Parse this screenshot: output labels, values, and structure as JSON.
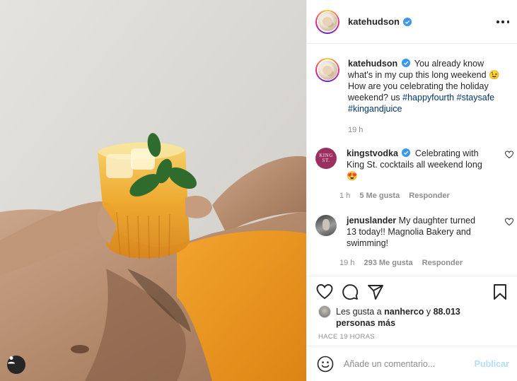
{
  "post": {
    "author": "katehudson",
    "more_icon": "more-horizontal-icon",
    "photo_alt": "photo",
    "tag_icon": "user-tag-icon"
  },
  "caption": {
    "username": "katehudson",
    "text_1": "You already know what's in my cup this long weekend",
    "emoji_1": "😉",
    "text_2": "How are you celebrating the holiday weekend? us",
    "hashtags": [
      "#happyfourth",
      "#staysafe",
      "#kingandjuice"
    ],
    "time": "19 h"
  },
  "comments": [
    {
      "username": "kingstvodka",
      "verified": true,
      "avatar_text": [
        "KING",
        "ST."
      ],
      "text": "Celebrating with King St. cocktails all weekend long",
      "emoji": "😍",
      "time": "1 h",
      "likes": "5 Me gusta",
      "reply": "Responder"
    },
    {
      "username": "jenuslander",
      "verified": false,
      "text": "My daughter turned 13 today!! Magnolia Bakery and swimming!",
      "time": "19 h",
      "likes": "293 Me gusta",
      "reply": "Responder"
    }
  ],
  "actions": {
    "icons": [
      "heart-icon",
      "comment-icon",
      "share-icon",
      "bookmark-icon"
    ],
    "likes_prefix": "Les gusta a",
    "likes_user": "nanherco",
    "likes_conj": "y",
    "likes_count": "88.013 personas más",
    "time_ago": "HACE 19 HORAS"
  },
  "add_comment": {
    "placeholder": "Añade un comentario...",
    "publish_label": "Publicar"
  },
  "colors": {
    "link": "#00376b",
    "verified": "#3897f0",
    "publish_disabled": "#b2dffc",
    "muted": "#8e8e8e"
  }
}
